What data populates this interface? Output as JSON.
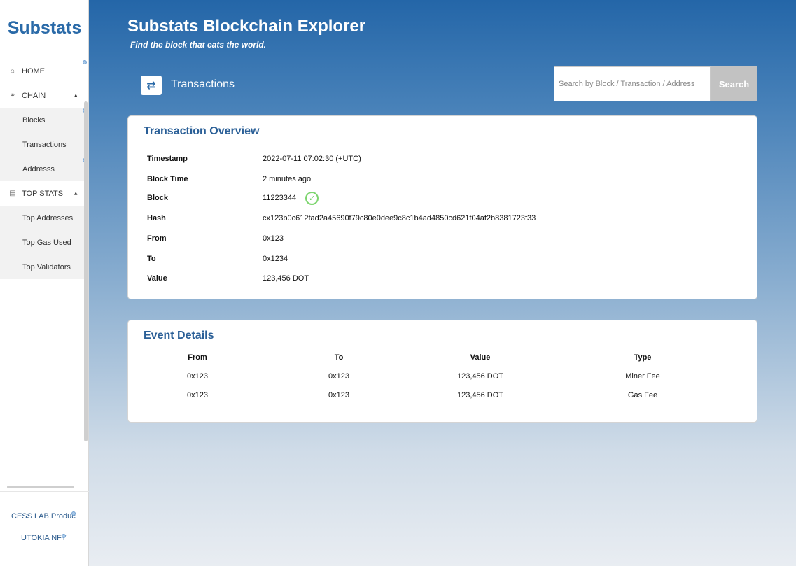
{
  "sidebar": {
    "logo": "Substats",
    "nav": {
      "home": "HOME",
      "chain": "CHAIN",
      "chain_items": [
        "Blocks",
        "Transactions",
        "Addresss"
      ],
      "top_stats": "TOP STATS",
      "top_stats_items": [
        "Top Addresses",
        "Top Gas Used",
        "Top Validators"
      ]
    },
    "footer": {
      "link1": "CESS LAB Products",
      "link2": "UTOKIA NFT"
    }
  },
  "header": {
    "title": "Substats Blockchain Explorer",
    "tagline": "Find the block that eats the world."
  },
  "page": {
    "heading": "Transactions"
  },
  "search": {
    "placeholder": "Search by Block / Transaction / Address",
    "button_label": "Search"
  },
  "overview": {
    "title": "Transaction Overview",
    "rows": [
      {
        "label": "Timestamp",
        "value": "2022-07-11 07:02:30 (+UTC)"
      },
      {
        "label": "Block Time",
        "value": "2 minutes ago"
      },
      {
        "label": "Block",
        "value": "11223344"
      },
      {
        "label": "Hash",
        "value": "cx123b0c612fad2a45690f79c80e0dee9c8c1b4ad4850cd621f04af2b8381723f33"
      },
      {
        "label": "From",
        "value": "0x123"
      },
      {
        "label": "To",
        "value": "0x1234"
      },
      {
        "label": "Value",
        "value": "123,456  DOT"
      }
    ]
  },
  "events": {
    "title": "Event Details",
    "columns": [
      "From",
      "To",
      "Value",
      "Type"
    ],
    "rows": [
      [
        "0x123",
        "0x123",
        "123,456  DOT",
        "Miner Fee"
      ],
      [
        "0x123",
        "0x123",
        "123,456  DOT",
        "Gas Fee"
      ]
    ]
  },
  "colors": {
    "brand": "#2a6aa8",
    "success": "#7dd56f"
  }
}
